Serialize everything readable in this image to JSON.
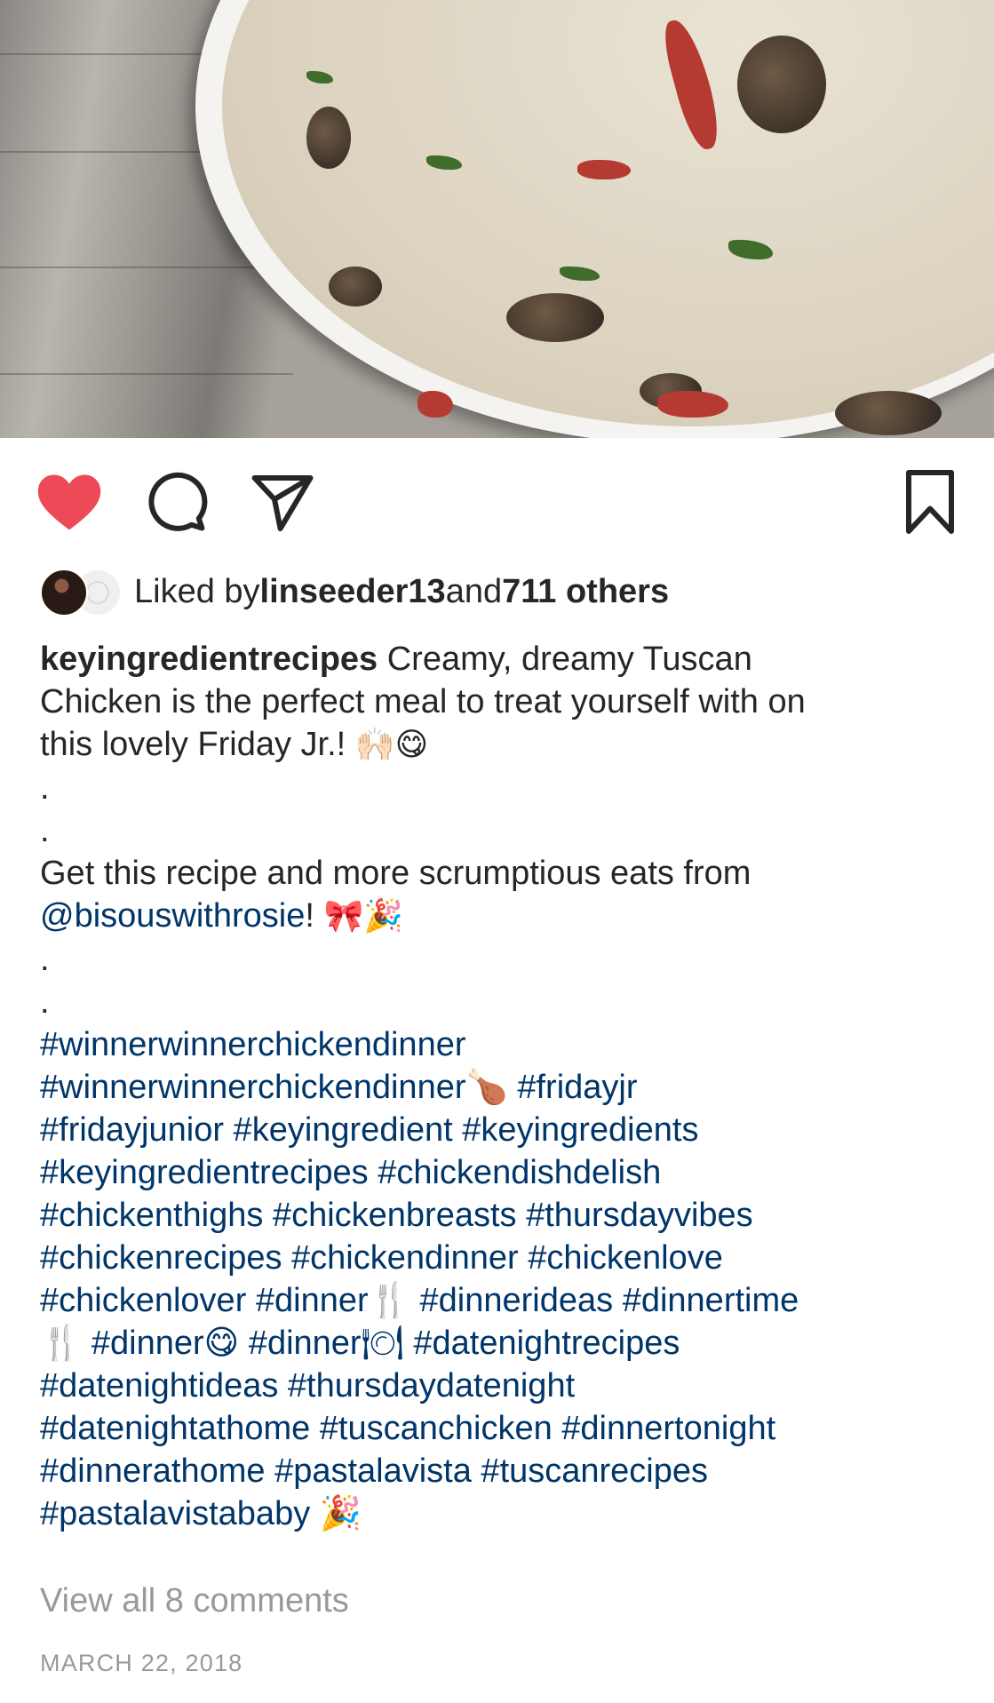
{
  "post": {
    "image_alt": "Creamy Tuscan chicken in a white bowl with mushrooms, tomatoes and herbs",
    "icons": {
      "like": "heart-filled-icon",
      "comment": "comment-bubble-icon",
      "share": "paper-plane-icon",
      "save": "bookmark-icon"
    },
    "like_color": "#ed4956",
    "liked_by": {
      "prefix": "Liked by ",
      "user": "linseeder13",
      "and": " and ",
      "others": "711 others"
    },
    "caption": {
      "username": "keyingredientrecipes",
      "line1": " Creamy, dreamy Tuscan",
      "line2": "Chicken is the perfect meal to treat yourself with on",
      "line3": "this lovely Friday Jr.! ",
      "emoji1": "🙌🏻😋",
      "dot": ".",
      "get_recipe": "Get this recipe and more scrumptious eats from",
      "mention": "@bisouswithrosie",
      "mention_tail": "! ",
      "emoji2": "🎀🎉",
      "hashtags": [
        "#winnerwinnerchickendinner",
        "#winnerwinnerchickendinner🍗 #fridayjr",
        "#fridayjunior #keyingredient #keyingredients",
        "#keyingredientrecipes #chickendishdelish",
        "#chickenthighs #chickenbreasts #thursdayvibes",
        "#chickenrecipes #chickendinner #chickenlove",
        "#chickenlover #dinner🍴 #dinnerideas #dinnertime",
        "🍴 #dinner😋 #dinner🍽 #datenightrecipes",
        "#datenightideas #thursdaydatenight",
        "#datenightathome #tuscanchicken #dinnertonight",
        "#dinnerathome #pastalavista #tuscanrecipes",
        "#pastalavistababy 🎉"
      ]
    },
    "view_comments": "View all 8 comments",
    "date": "MARCH 22, 2018",
    "link_color": "#003569"
  }
}
